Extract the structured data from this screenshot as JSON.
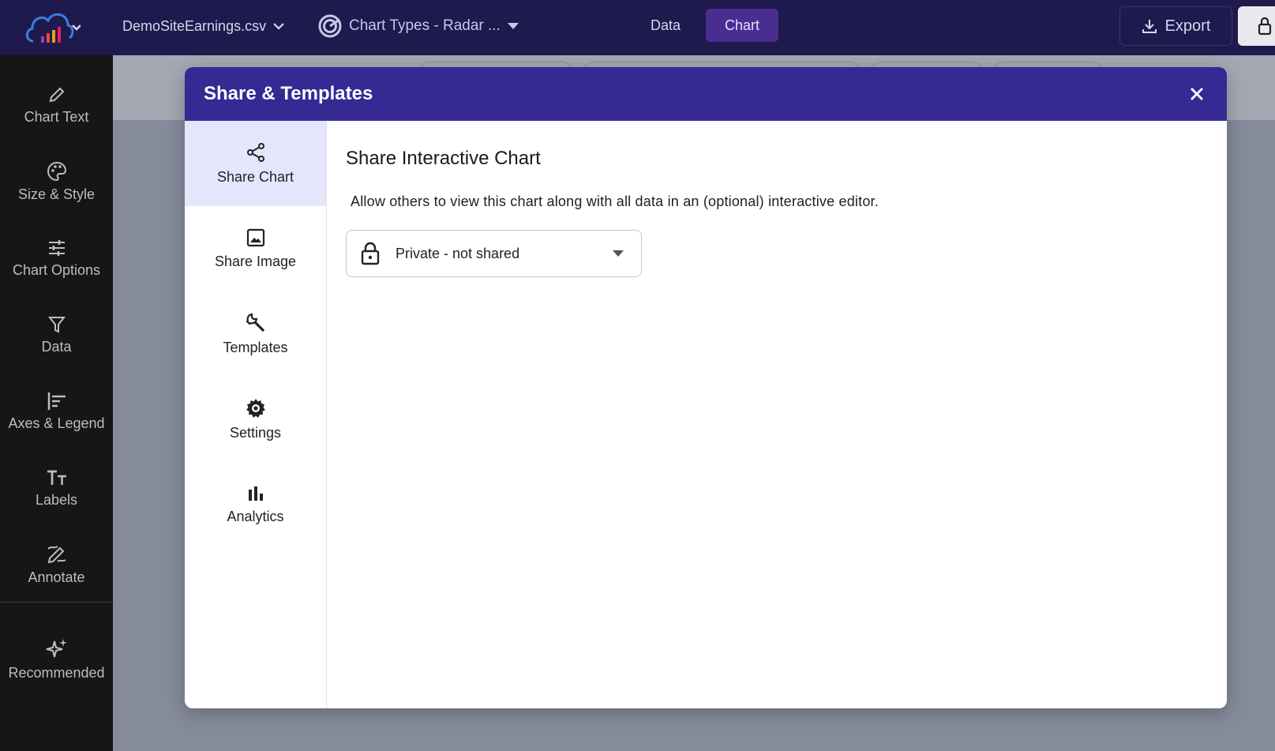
{
  "topbar": {
    "file_name": "DemoSiteEarnings.csv",
    "chart_type": "Chart Types - Radar ...",
    "tabs": [
      {
        "label": "Data",
        "active": false
      },
      {
        "label": "Chart",
        "active": true
      }
    ],
    "export_label": "Export"
  },
  "sidebar": {
    "items": [
      {
        "label": "Chart Text",
        "icon": "pencil-icon"
      },
      {
        "label": "Size & Style",
        "icon": "palette-icon"
      },
      {
        "label": "Chart Options",
        "icon": "sliders-icon"
      },
      {
        "label": "Data",
        "icon": "filter-icon"
      },
      {
        "label": "Axes & Legend",
        "icon": "axes-icon"
      },
      {
        "label": "Labels",
        "icon": "text-size-icon"
      },
      {
        "label": "Annotate",
        "icon": "annotate-icon"
      },
      {
        "label": "Recommended",
        "icon": "sparkle-icon"
      }
    ]
  },
  "modal": {
    "title": "Share & Templates",
    "nav": [
      {
        "label": "Share Chart",
        "icon": "share-icon",
        "active": true
      },
      {
        "label": "Share Image",
        "icon": "image-icon",
        "active": false
      },
      {
        "label": "Templates",
        "icon": "wrench-icon",
        "active": false
      },
      {
        "label": "Settings",
        "icon": "gear-icon",
        "active": false
      },
      {
        "label": "Analytics",
        "icon": "bar-chart-icon",
        "active": false
      }
    ],
    "content": {
      "title": "Share Interactive Chart",
      "description": "Allow others to view this chart along with all data in an (optional) interactive editor.",
      "privacy_value": "Private - not shared"
    }
  },
  "colors": {
    "topbar_bg": "#1e1a4d",
    "modal_header_bg": "#362994",
    "active_tab_bg": "#4b2d91",
    "active_nav_bg": "#e4e6fb",
    "sidebar_bg": "#161616"
  }
}
